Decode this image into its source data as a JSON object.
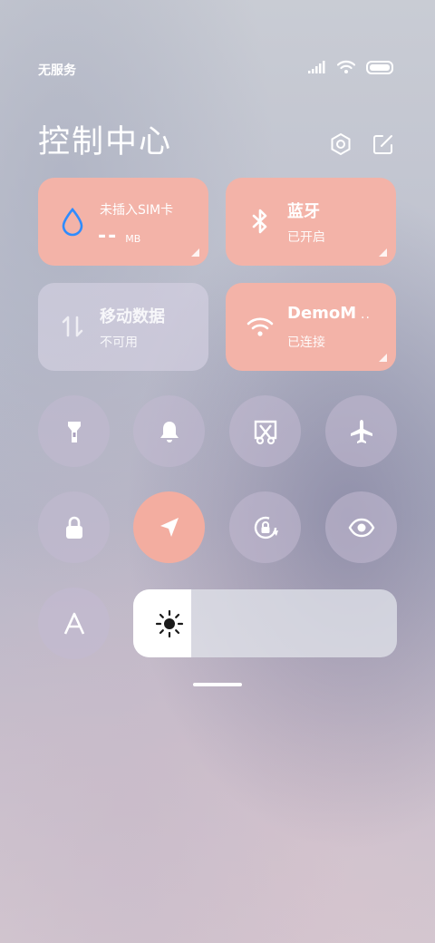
{
  "status_bar": {
    "carrier": "无服务",
    "icons": [
      "signal-icon",
      "wifi-icon",
      "battery-icon"
    ]
  },
  "header": {
    "title": "控制中心",
    "icons": [
      "settings-icon",
      "edit-icon"
    ]
  },
  "tiles": {
    "data_usage": {
      "title": "未插入SIM卡",
      "value": "--",
      "unit": "MB",
      "icon": "water-drop-icon"
    },
    "bluetooth": {
      "title": "蓝牙",
      "status": "已开启",
      "icon": "bluetooth-icon"
    },
    "mobile_data": {
      "title": "移动数据",
      "status": "不可用",
      "icon": "data-transfer-icon"
    },
    "wifi": {
      "title": "DemoM",
      "more": "··",
      "status": "已连接",
      "icon": "wifi-icon"
    }
  },
  "toggles": [
    {
      "name": "flashlight",
      "icon": "flashlight-icon",
      "active": false
    },
    {
      "name": "sound",
      "icon": "bell-icon",
      "active": false
    },
    {
      "name": "screenshot",
      "icon": "screenshot-icon",
      "active": false
    },
    {
      "name": "airplane-mode",
      "icon": "airplane-icon",
      "active": false
    },
    {
      "name": "lock-screen",
      "icon": "lock-icon",
      "active": false
    },
    {
      "name": "location",
      "icon": "location-arrow-icon",
      "active": true
    },
    {
      "name": "rotation-lock",
      "icon": "rotation-lock-icon",
      "active": false
    },
    {
      "name": "reading-mode",
      "icon": "eye-icon",
      "active": false
    },
    {
      "name": "font-size",
      "icon": "font-icon",
      "label": "A",
      "active": false
    }
  ],
  "brightness": {
    "level": 0.22,
    "icon": "sun-icon"
  },
  "colors": {
    "accent_tile": "#f3b3a8",
    "accent_button": "#f3ada0",
    "text": "#ffffff"
  }
}
